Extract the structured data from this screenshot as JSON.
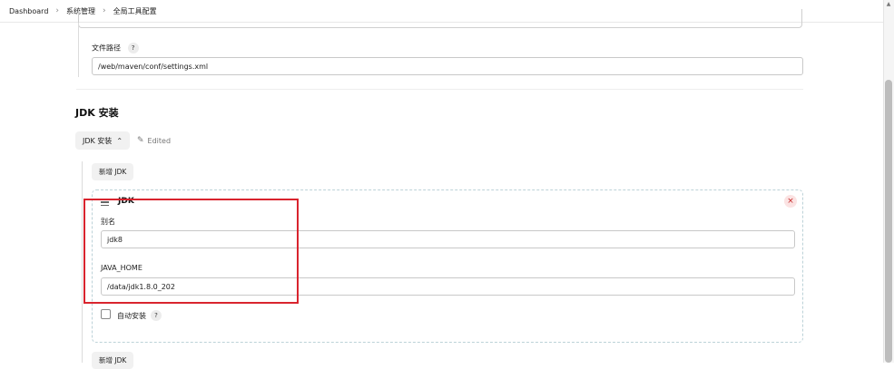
{
  "breadcrumb": {
    "items": [
      "Dashboard",
      "系统管理",
      "全局工具配置"
    ]
  },
  "maven": {
    "file_path_label": "文件路径",
    "file_path_value": "/web/maven/conf/settings.xml",
    "help": "?"
  },
  "jdk_section": {
    "title": "JDK 安装",
    "toggle_label": "JDK 安装",
    "edited_label": "Edited",
    "add_button_label": "新增 JDK",
    "add_button_bottom_label": "新增 JDK",
    "card": {
      "title": "JDK",
      "close_symbol": "×",
      "alias_label": "别名",
      "alias_value": "jdk8",
      "java_home_label": "JAVA_HOME",
      "java_home_value": "/data/jdk1.8.0_202",
      "auto_install_label": "自动安装",
      "auto_install_checked": false,
      "help": "?"
    }
  },
  "annotation": {
    "highlight_color": "#d9242e"
  }
}
